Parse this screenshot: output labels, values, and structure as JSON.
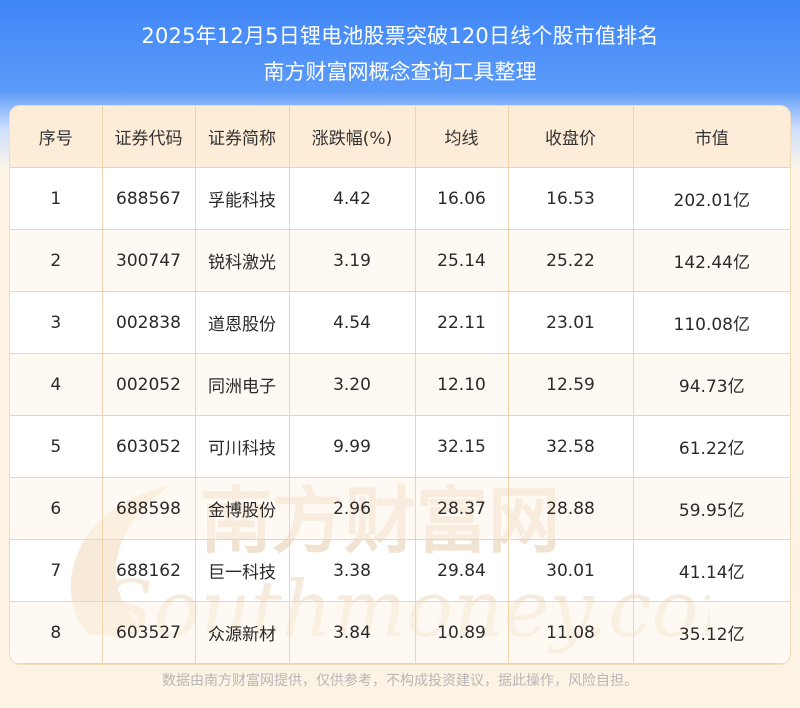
{
  "header": {
    "title_line1": "2025年12月5日锂电池股票突破120日线个股市值排名",
    "title_line2": "南方财富网概念查询工具整理"
  },
  "table": {
    "columns": [
      "序号",
      "证券代码",
      "证券简称",
      "涨跌幅(%)",
      "均线",
      "收盘价",
      "市值"
    ],
    "rows": [
      [
        "1",
        "688567",
        "孚能科技",
        "4.42",
        "16.06",
        "16.53",
        "202.01亿"
      ],
      [
        "2",
        "300747",
        "锐科激光",
        "3.19",
        "25.14",
        "25.22",
        "142.44亿"
      ],
      [
        "3",
        "002838",
        "道恩股份",
        "4.54",
        "22.11",
        "23.01",
        "110.08亿"
      ],
      [
        "4",
        "002052",
        "同洲电子",
        "3.20",
        "12.10",
        "12.59",
        "94.73亿"
      ],
      [
        "5",
        "603052",
        "可川科技",
        "9.99",
        "32.15",
        "32.58",
        "61.22亿"
      ],
      [
        "6",
        "688598",
        "金博股份",
        "2.96",
        "28.37",
        "28.88",
        "59.95亿"
      ],
      [
        "7",
        "688162",
        "巨一科技",
        "3.38",
        "29.84",
        "30.01",
        "41.14亿"
      ],
      [
        "8",
        "603527",
        "众源新材",
        "3.84",
        "10.89",
        "11.08",
        "35.12亿"
      ]
    ]
  },
  "watermark": {
    "text_cn": "南方财富网",
    "text_en": "Southmoney.com"
  },
  "footer": {
    "disclaimer": "数据由南方财富网提供，仅供参考，不构成投资建议，据此操作，风险自担。"
  },
  "colors": {
    "header_blue": "#3f86f7",
    "table_header_bg": "#fdecd7",
    "grid_line": "#f0d4ae",
    "watermark": "#f5e7d6"
  }
}
